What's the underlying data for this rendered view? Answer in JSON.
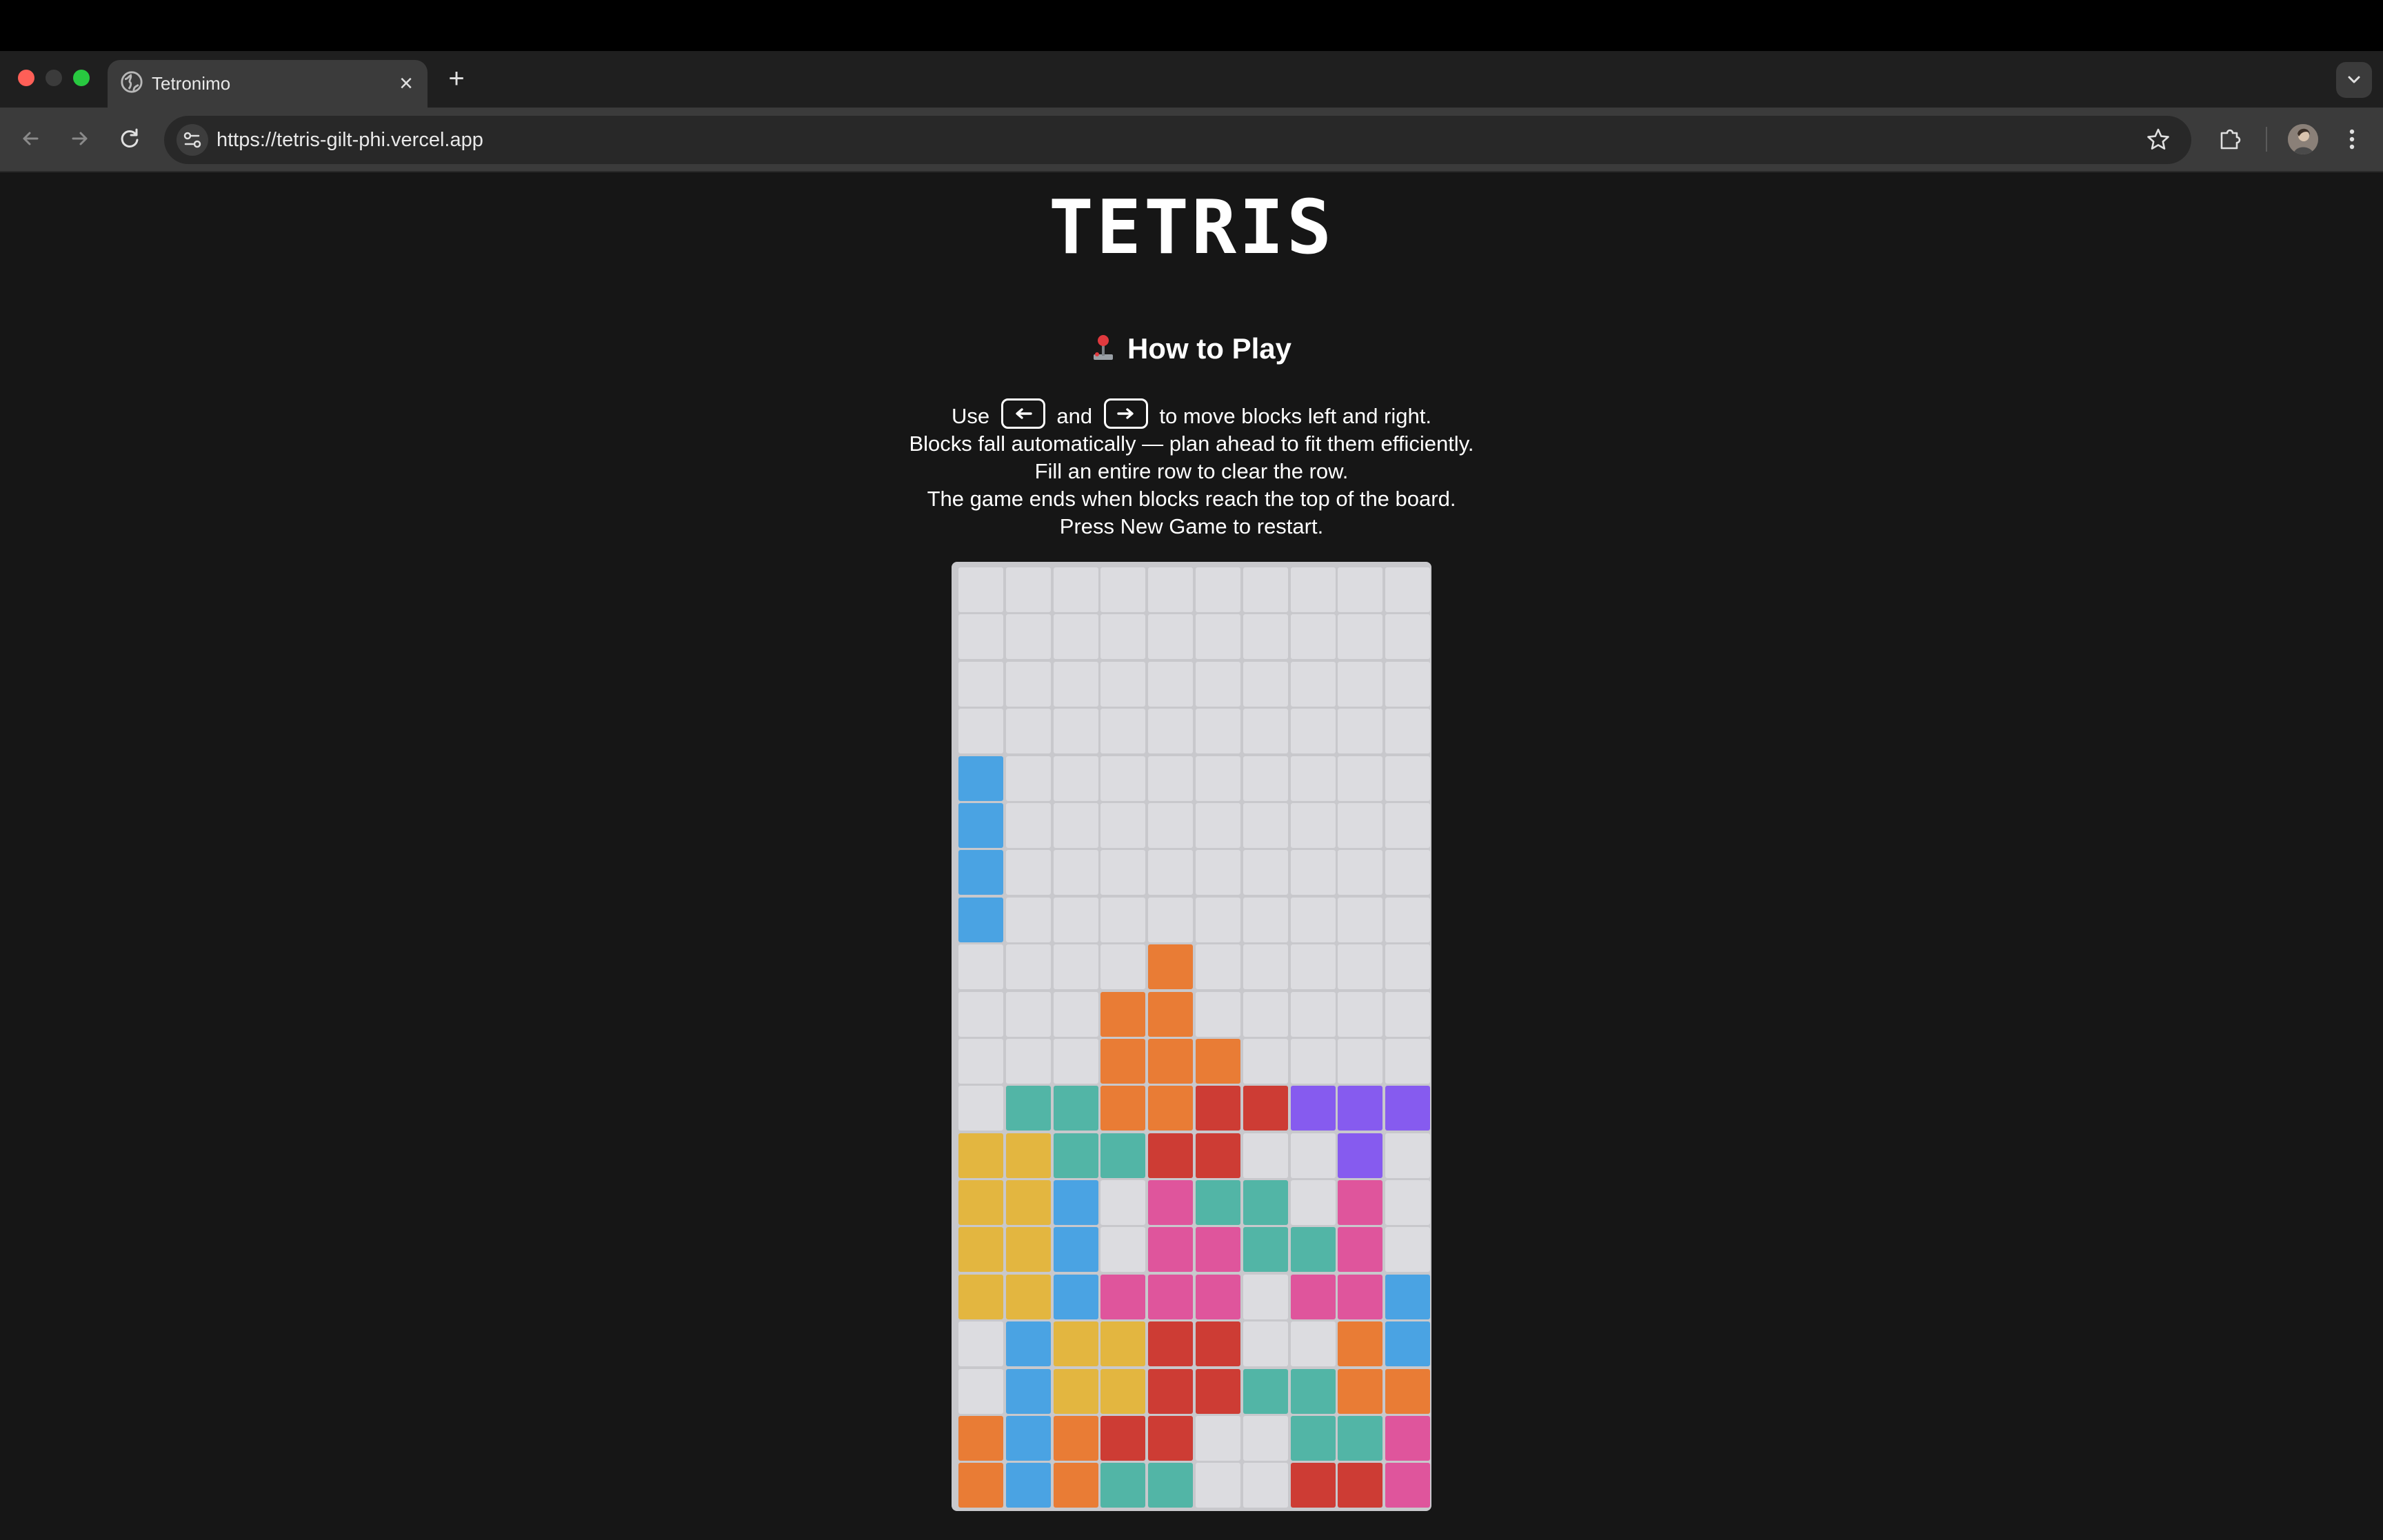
{
  "browser": {
    "tab_title": "Tetronimo",
    "url": "https://tetris-gilt-phi.vercel.app",
    "new_tab_symbol": "+",
    "close_symbol": "×"
  },
  "page": {
    "title": "TETRIS",
    "how_to_play_heading": "How to Play",
    "instructions": {
      "line1_prefix": "Use",
      "line1_and": "and",
      "line1_suffix": "to move blocks left and right.",
      "line2": "Blocks fall automatically — plan ahead to fit them efficiently.",
      "line3": "Fill an entire row to clear the row.",
      "line4": "The game ends when blocks reach the top of the board.",
      "line5": "Press New Game to restart."
    },
    "keys": {
      "left": "left-arrow-icon",
      "right": "right-arrow-icon"
    }
  },
  "colors": {
    "background": "#161616",
    "board": "#c8c8cc",
    "empty": "#dcdce0",
    "B": "#4aa3e3",
    "O": "#e97c35",
    "G": "#52b5a6",
    "R": "#cd3c34",
    "P": "#865bef",
    "Y": "#e3b640",
    "K": "#df559c"
  },
  "board": {
    "columns": 10,
    "rows": 20,
    "grid": [
      "..........",
      "..........",
      "..........",
      "..........",
      "B.........",
      "B.........",
      "B.........",
      "B.........",
      "....O.....",
      "...OO.....",
      "...OOO....",
      ".GGOORRPPP",
      "YYGGRR..P.",
      "YYB.KGG.K.",
      "YYB.KKGGK.",
      "YYBKKK.KKB",
      ".BYYRR..OB",
      ".BYYRRGGOO",
      "OBORR..GGK",
      "OBOGG..RRK"
    ]
  }
}
